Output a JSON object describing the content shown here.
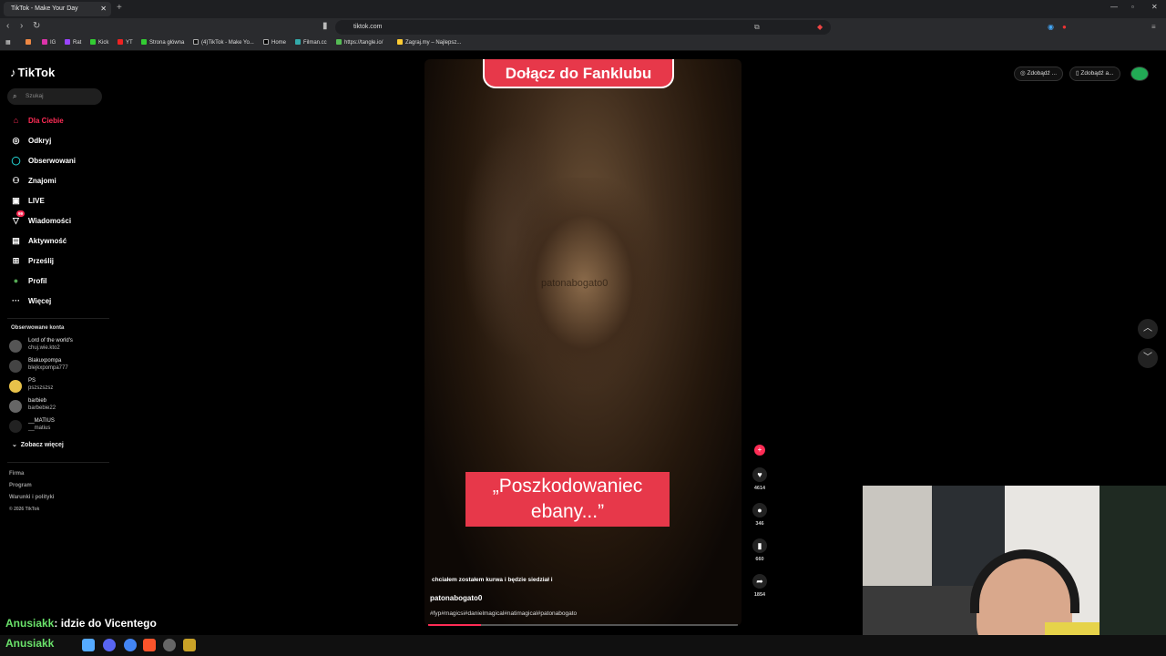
{
  "browser": {
    "tab_title": "TikTok - Make Your Day",
    "url": "tiktok.com",
    "bookmarks": [
      "IG",
      "Rat",
      "Kick",
      "YT",
      "Strona główna",
      "(4)TikTok - Make Yo...",
      "Home",
      "Filman.cc",
      "https://tangle.io/",
      "Zagraj.my – Najlepsz..."
    ]
  },
  "sidebar": {
    "logo": "TikTok",
    "search_placeholder": "Szukaj",
    "nav": [
      "Dla Ciebie",
      "Odkryj",
      "Obserwowani",
      "Znajomi",
      "LIVE",
      "Wiadomości",
      "Aktywność",
      "Prześlij",
      "Profil",
      "Więcej"
    ],
    "messages_badge": "99",
    "followed_header": "Obserwowane konta",
    "followed": [
      {
        "name": "Lord of the world's",
        "handle": "chuj.wie.kto2"
      },
      {
        "name": "Blakuxpompa",
        "handle": "blejkxpompa777"
      },
      {
        "name": "PS",
        "handle": "pszszszsz"
      },
      {
        "name": "barbieb",
        "handle": "barbebie22"
      },
      {
        "name": "__MATIUS",
        "handle": "__matius"
      }
    ],
    "see_more": "Zobacz więcej",
    "footer": [
      "Firma",
      "Program",
      "Warunki i polityki",
      "© 2026 TikTok"
    ]
  },
  "video": {
    "top_banner": "Dołącz do Fanklubu",
    "watermark": "patonabogato0",
    "caption": "„Poszkodowaniec ebany...”",
    "description": "chciałem zostałem kurwa i będzie siedział i",
    "username": "patonabogato0",
    "hashtags": "#fyp#magicsi#danielmagical#natimagical#patonabogato",
    "progress": 0.17
  },
  "actions": {
    "likes": "4614",
    "comments": "346",
    "saves": "660",
    "shares": "1854"
  },
  "topright": {
    "coins_label": "Zdobądź ...",
    "app_label": "Zdobądź a..."
  },
  "chat": {
    "user": "Anusiakk",
    "message": ": idzie do Vicentego"
  },
  "taskbar": {
    "label": "Anusiakk"
  }
}
